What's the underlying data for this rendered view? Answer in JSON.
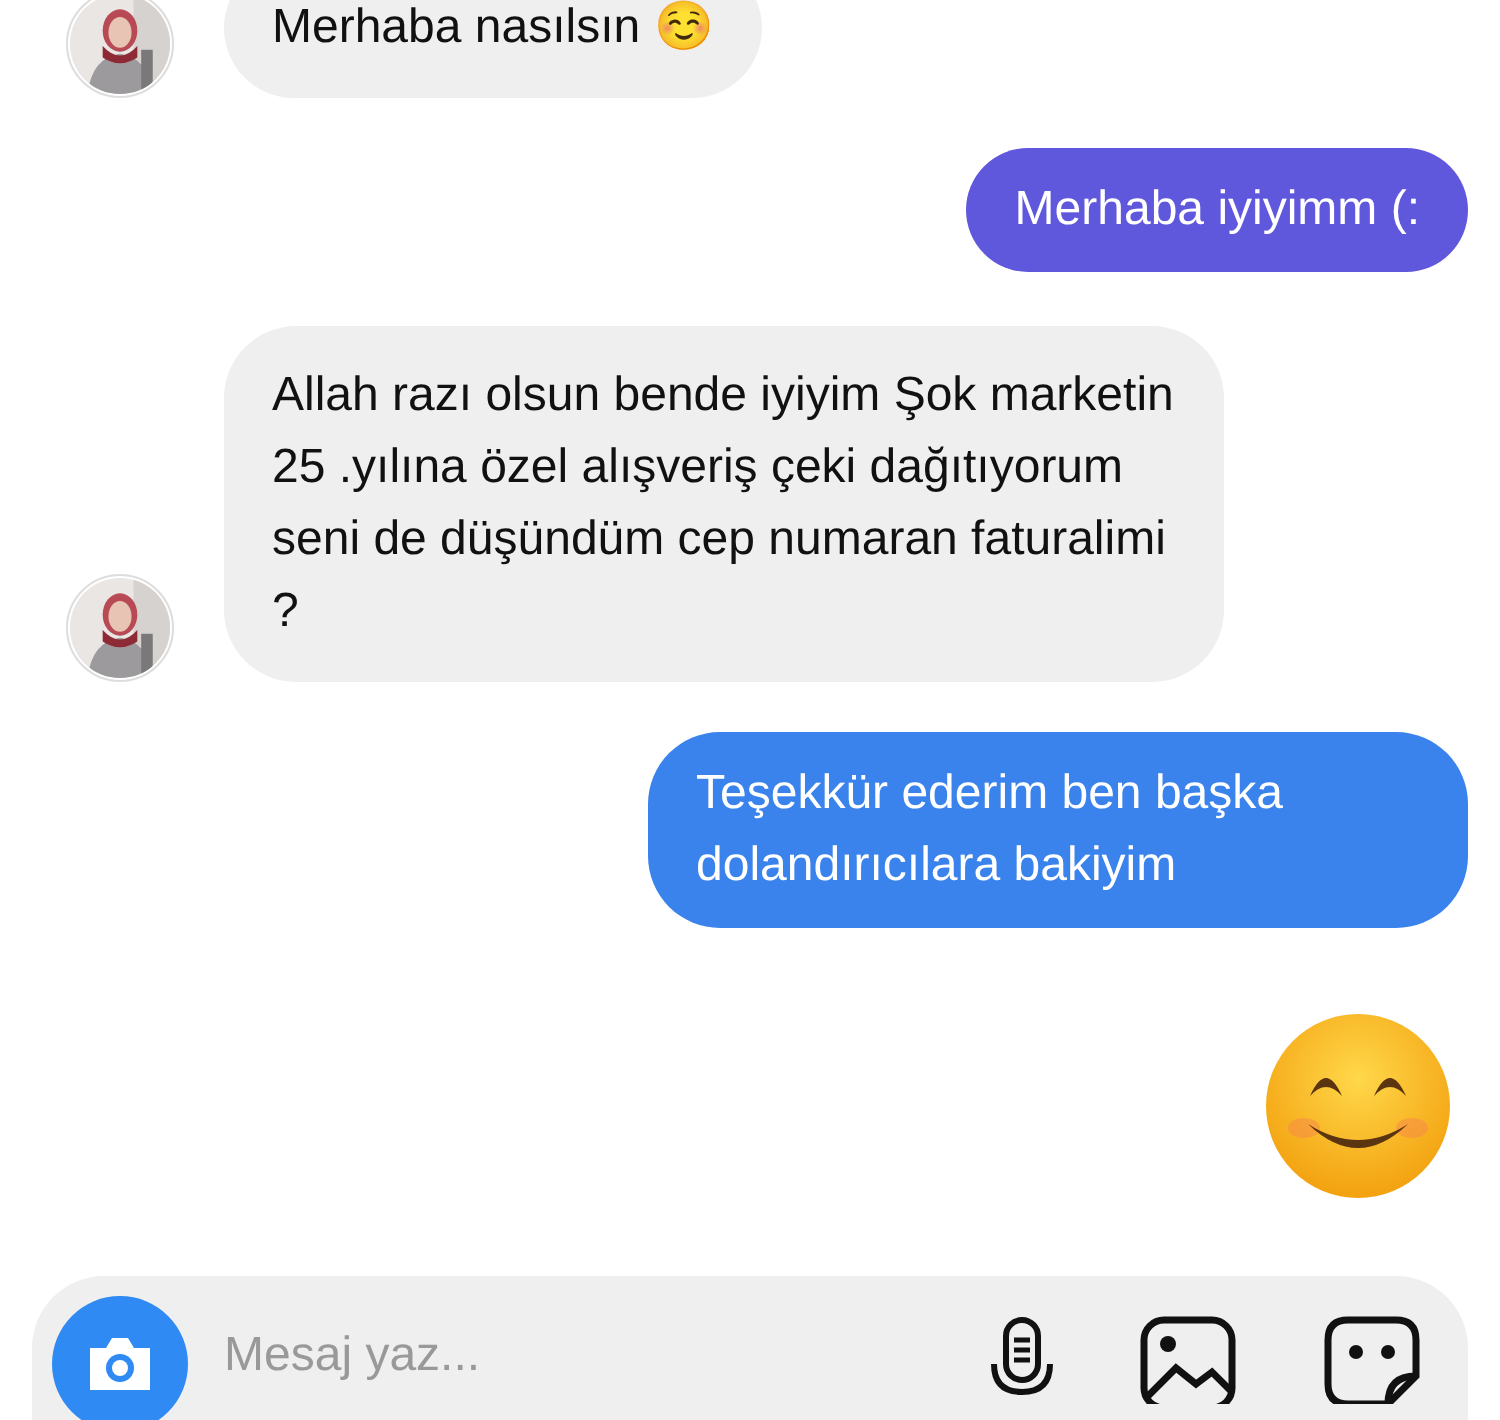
{
  "messages": [
    {
      "kind": "incoming",
      "text": "Merhaba nasılsın ☺️",
      "avatar": true
    },
    {
      "kind": "outgoing",
      "text": "Merhaba iyiyimm (:",
      "color": "#5f58dc"
    },
    {
      "kind": "incoming",
      "text": "Allah razı olsun bende iyiyim Şok marketin 25 .yılına özel alışveriş çeki dağıtıyorum seni de düşündüm cep numaran faturalimi ?",
      "avatar": true
    },
    {
      "kind": "outgoing",
      "text": "Teşekkür ederim ben başka dolandırıcılara bakiyim",
      "color": "#3a83ec"
    },
    {
      "kind": "emoji"
    }
  ],
  "composer": {
    "placeholder": "Mesaj yaz..."
  }
}
